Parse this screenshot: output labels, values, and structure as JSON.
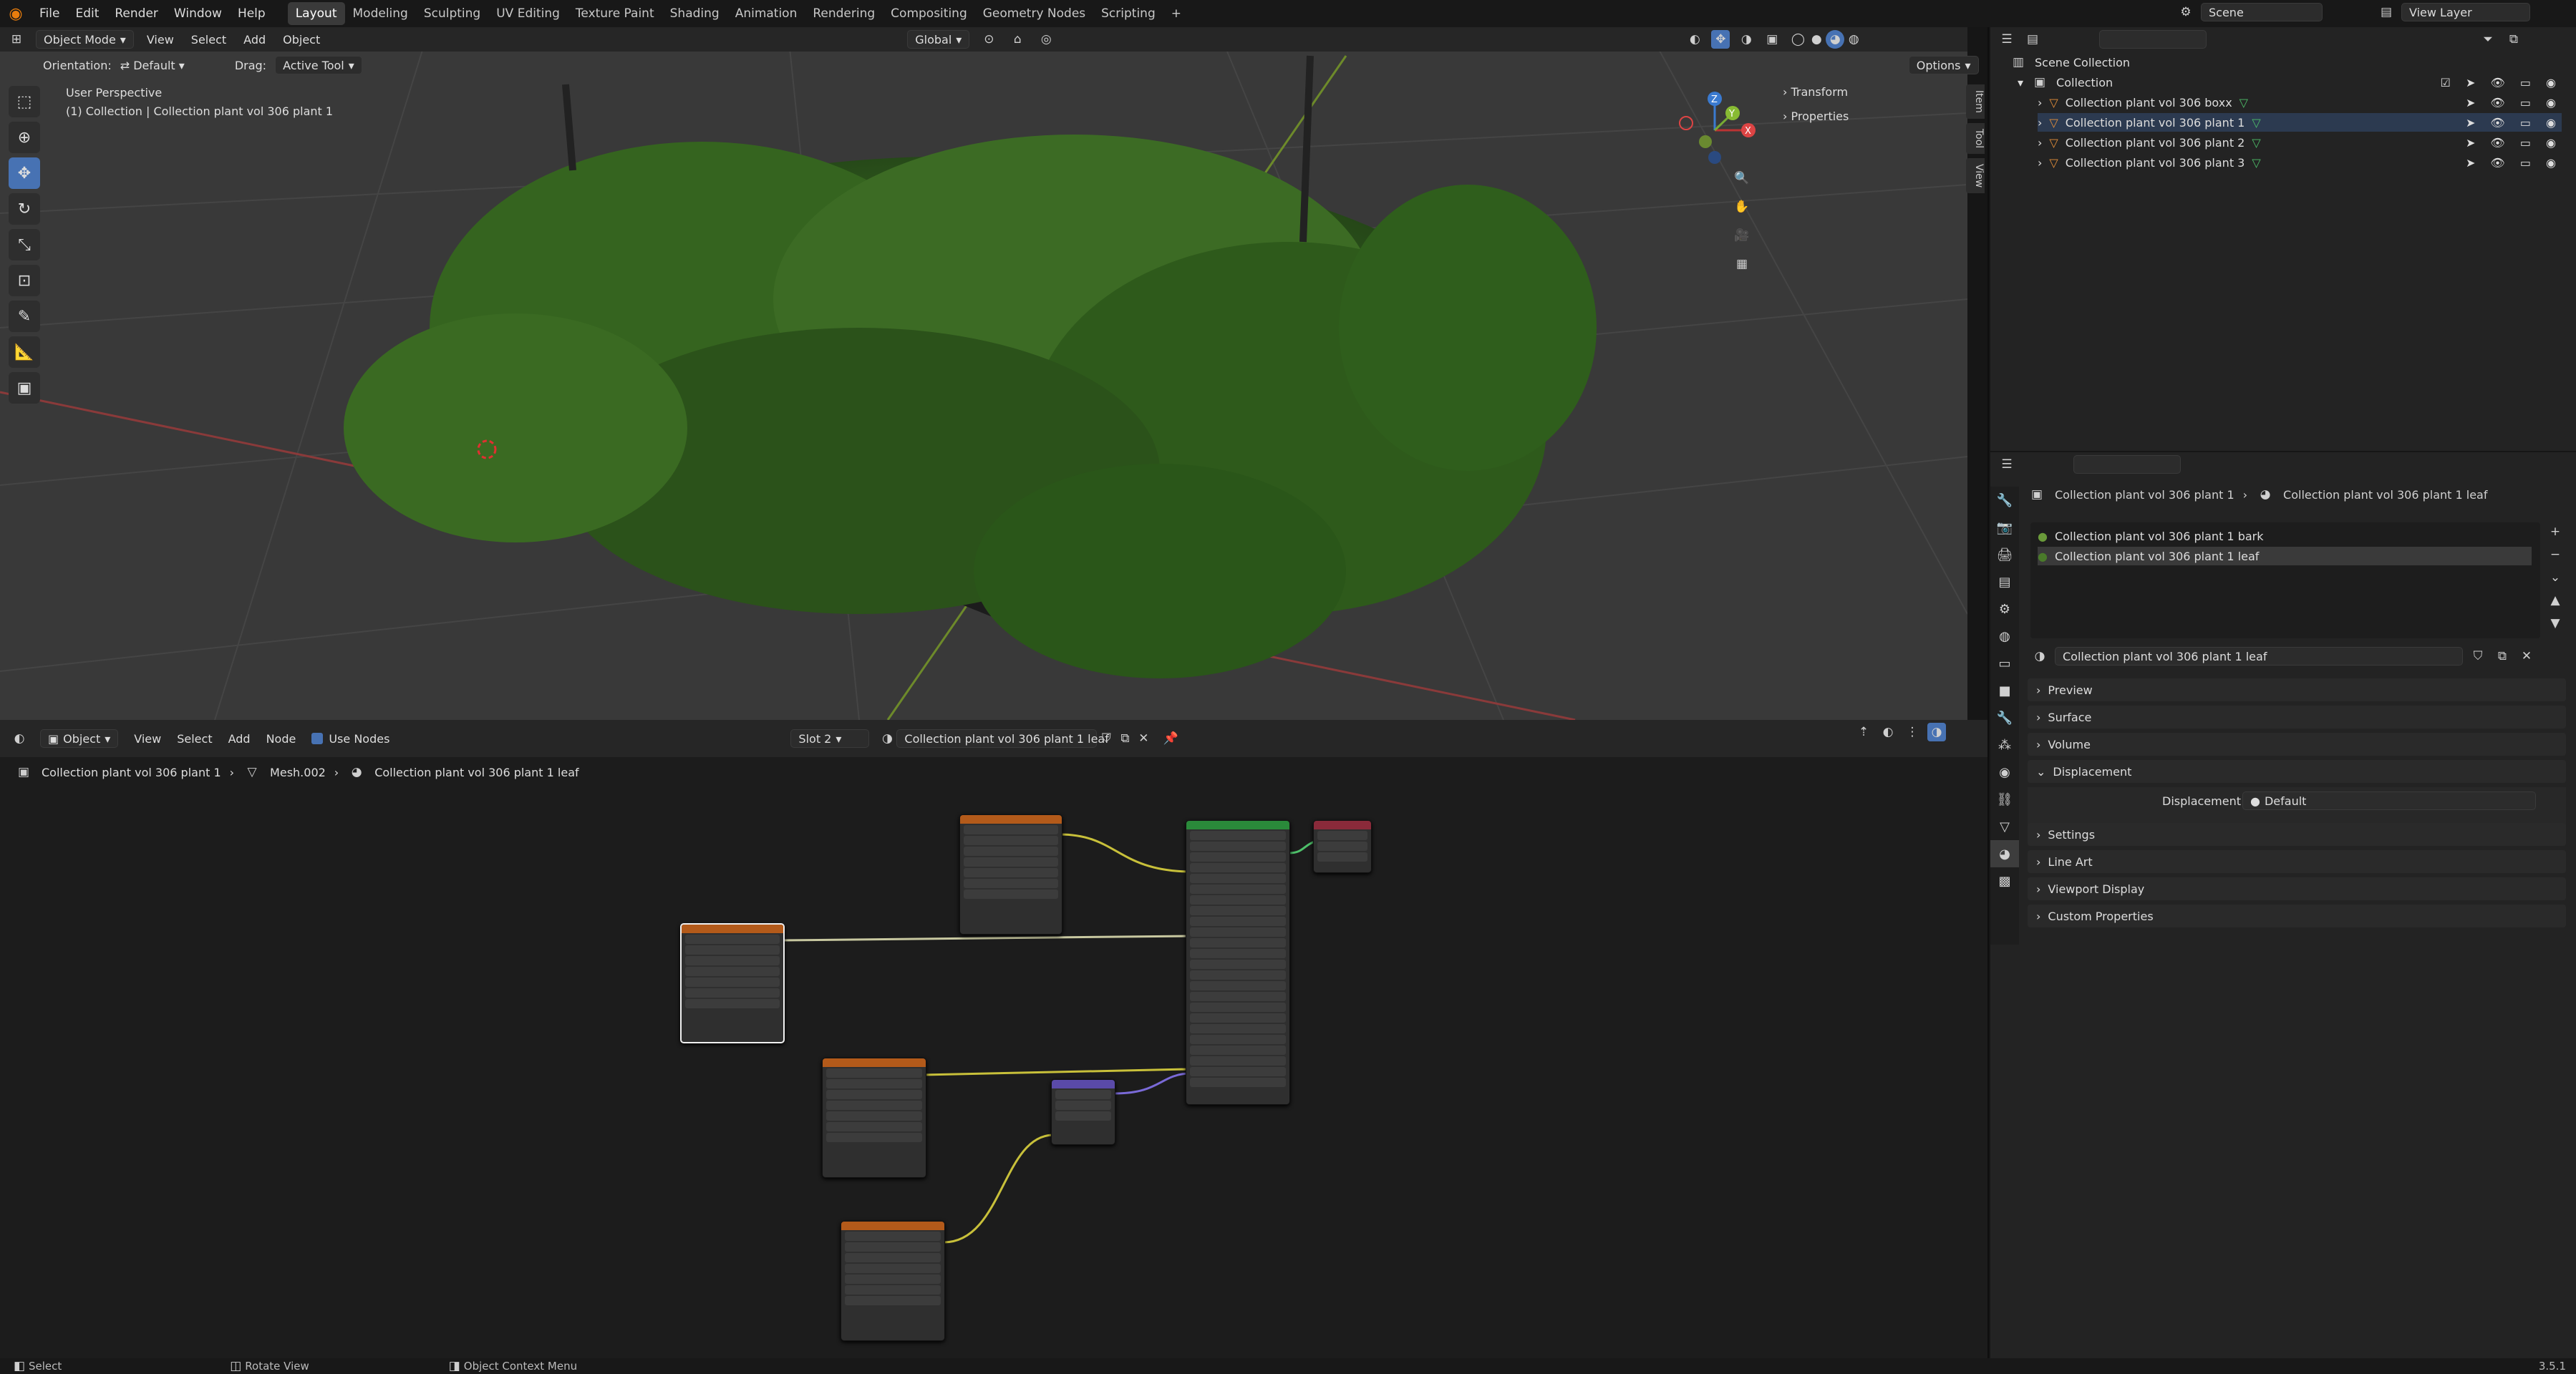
{
  "menu": {
    "items": [
      "File",
      "Edit",
      "Render",
      "Window",
      "Help"
    ],
    "workspaces": [
      "Layout",
      "Modeling",
      "Sculpting",
      "UV Editing",
      "Texture Paint",
      "Shading",
      "Animation",
      "Rendering",
      "Compositing",
      "Geometry Nodes",
      "Scripting"
    ],
    "active_workspace": "Layout",
    "add_tab": "+",
    "scene_label": "Scene",
    "view_layer_label": "View Layer"
  },
  "viewport": {
    "mode": "Object Mode",
    "menus": [
      "View",
      "Select",
      "Add",
      "Object"
    ],
    "transform_orientation": "Global",
    "orientation_label": "Orientation:",
    "orientation_value": "Default",
    "drag_label": "Drag:",
    "drag_value": "Active Tool",
    "options": "Options",
    "perspective": "User Perspective",
    "object_info": "(1) Collection | Collection plant vol 306 plant 1",
    "n_panel": [
      "Transform",
      "Properties"
    ],
    "side_tabs": [
      "Item",
      "Tool",
      "View"
    ],
    "gizmo_axes": [
      "X",
      "Y",
      "Z"
    ]
  },
  "node_editor": {
    "type": "Object",
    "menus": [
      "View",
      "Select",
      "Add",
      "Node"
    ],
    "use_nodes_label": "Use Nodes",
    "slot": "Slot 2",
    "material": "Collection plant vol 306 plant 1 leaf",
    "breadcrumb": [
      "Collection plant vol 306 plant 1",
      "Mesh.002",
      "Collection plant vol 306 plant 1 leaf"
    ]
  },
  "outliner": {
    "search_placeholder": "",
    "root": "Scene Collection",
    "collection": "Collection",
    "items": [
      {
        "label": "Collection plant vol 306 boxx"
      },
      {
        "label": "Collection plant vol 306 plant 1"
      },
      {
        "label": "Collection plant vol 306 plant 2"
      },
      {
        "label": "Collection plant vol 306 plant 3"
      }
    ]
  },
  "properties": {
    "breadcrumb_object": "Collection plant vol 306 plant 1",
    "breadcrumb_material": "Collection plant vol 306 plant 1 leaf",
    "slots": [
      "Collection plant vol 306 plant 1 bark",
      "Collection plant vol 306 plant 1 leaf"
    ],
    "material_name": "Collection plant vol 306 plant 1 leaf",
    "panels": [
      "Preview",
      "Surface",
      "Volume",
      "Displacement",
      "Settings",
      "Line Art",
      "Viewport Display",
      "Custom Properties"
    ],
    "displacement_label": "Displacement",
    "displacement_value": "Default"
  },
  "status": {
    "select": "Select",
    "rotate": "Rotate View",
    "context": "Object Context Menu",
    "version": "3.5.1"
  },
  "colors": {
    "accent": "#4772b3",
    "brand": "#e87d0d"
  }
}
